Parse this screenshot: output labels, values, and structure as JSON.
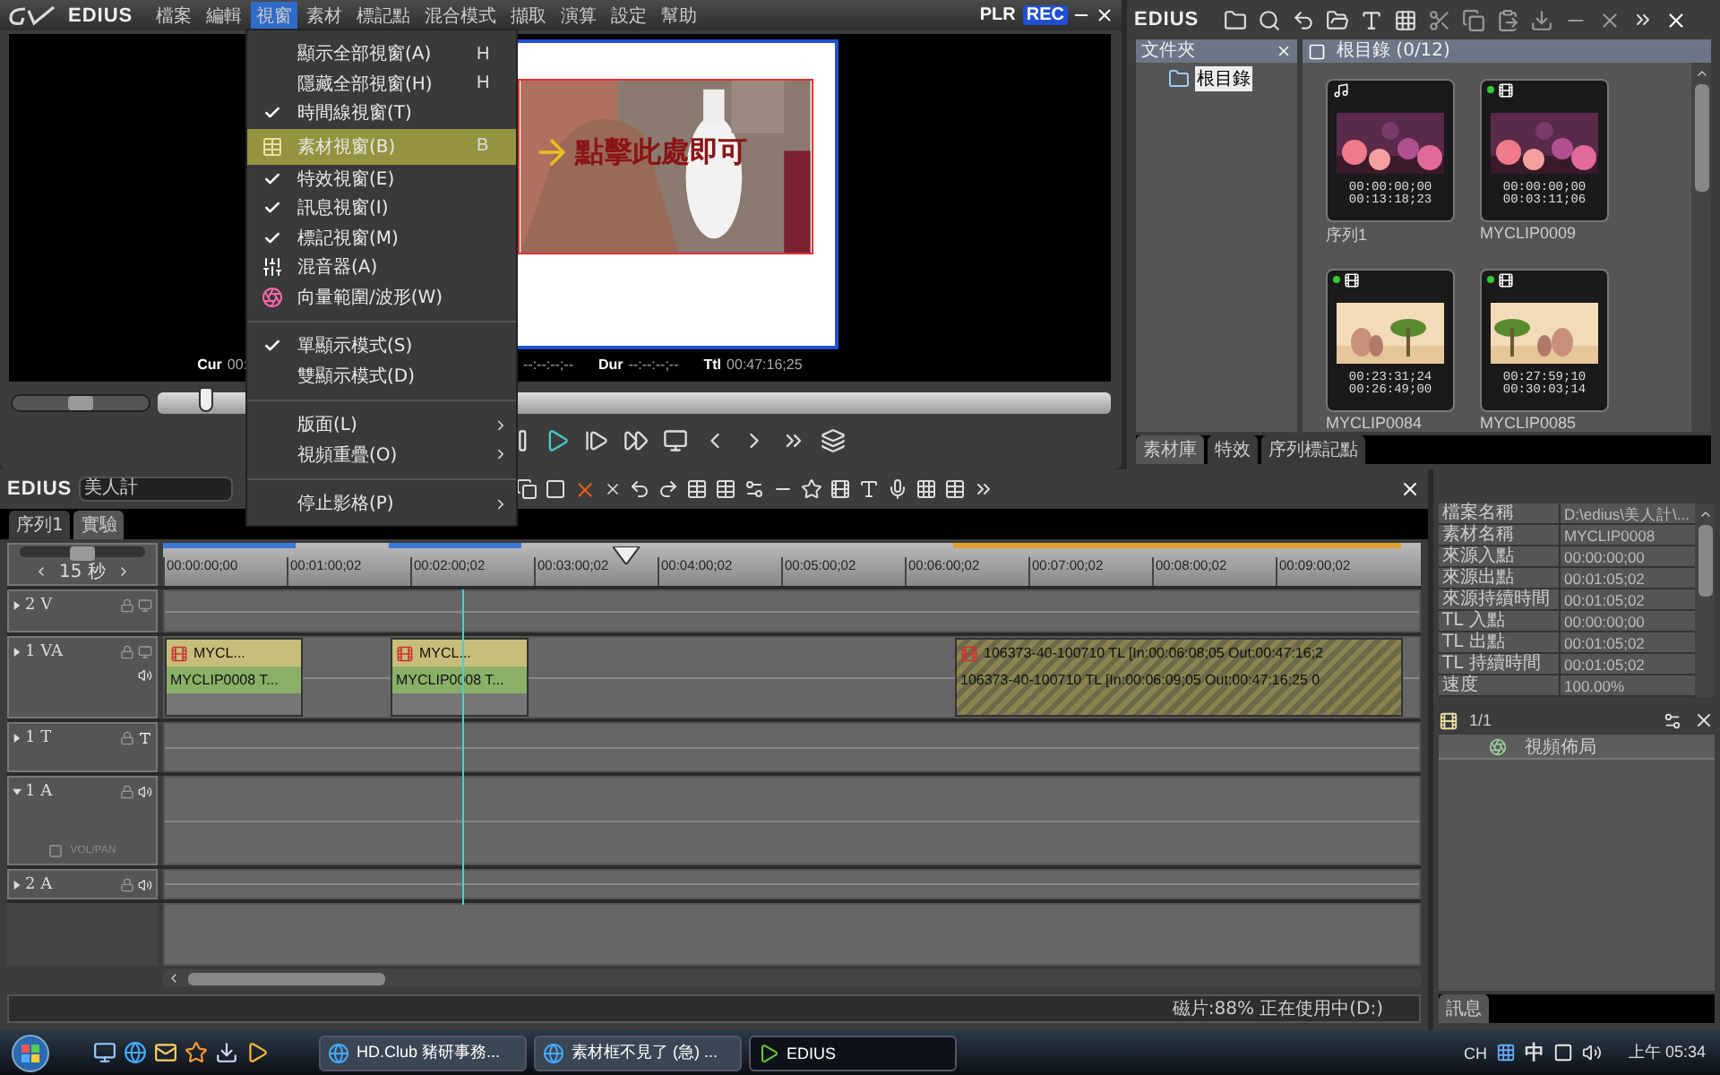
{
  "menubar": {
    "logo": "EDIUS",
    "items": [
      {
        "label": "檔案",
        "selected": false
      },
      {
        "label": "編輯",
        "selected": false
      },
      {
        "label": "視窗",
        "selected": true
      },
      {
        "label": "素材",
        "selected": false
      },
      {
        "label": "標記點",
        "selected": false
      },
      {
        "label": "混合模式",
        "selected": false
      },
      {
        "label": "擷取",
        "selected": false
      },
      {
        "label": "演算",
        "selected": false
      },
      {
        "label": "設定",
        "selected": false
      },
      {
        "label": "幫助",
        "selected": false
      }
    ],
    "mode_tabs": [
      {
        "label": "PLR",
        "selected": false
      },
      {
        "label": "REC",
        "selected": true
      }
    ]
  },
  "view_menu": [
    {
      "label": "顯示全部視窗(A)",
      "shortcut": "H",
      "kind": "text",
      "checked": false,
      "submenu": false,
      "selected": false
    },
    {
      "label": "隱藏全部視窗(H)",
      "shortcut": "H",
      "kind": "text",
      "checked": false,
      "submenu": false,
      "selected": false
    },
    {
      "label": "時間線視窗(T)",
      "kind": "text",
      "checked": true,
      "submenu": false,
      "selected": false
    },
    {
      "label": "素材視窗(B)",
      "shortcut": "B",
      "kind": "bin",
      "submenu": false,
      "selected": true
    },
    {
      "label": "特效視窗(E)",
      "kind": "text",
      "checked": true,
      "submenu": false,
      "selected": false
    },
    {
      "label": "訊息視窗(I)",
      "kind": "text",
      "checked": true,
      "submenu": false,
      "selected": false
    },
    {
      "label": "標記視窗(M)",
      "kind": "text",
      "checked": true,
      "submenu": false,
      "selected": false
    },
    {
      "label": "混音器(A)",
      "kind": "mixer",
      "submenu": false,
      "selected": false
    },
    {
      "label": "向量範圍/波形(W)",
      "kind": "scope",
      "submenu": false,
      "selected": false
    },
    {
      "kind": "separator"
    },
    {
      "label": "單顯示模式(S)",
      "kind": "text",
      "checked": true,
      "submenu": false,
      "selected": false
    },
    {
      "label": "雙顯示模式(D)",
      "kind": "text",
      "checked": false,
      "submenu": false,
      "selected": false
    },
    {
      "kind": "separator"
    },
    {
      "label": "版面(L)",
      "kind": "text",
      "checked": false,
      "submenu": true,
      "selected": false
    },
    {
      "label": "視頻重疊(O)",
      "kind": "text",
      "checked": false,
      "submenu": true,
      "selected": false
    },
    {
      "kind": "separator"
    },
    {
      "label": "停止影格(P)",
      "kind": "text",
      "checked": false,
      "submenu": true,
      "selected": false
    }
  ],
  "player": {
    "annotation": "點擊此處即可",
    "jog": {
      "level": 0.5
    },
    "shuttle": {
      "level": 0.05
    },
    "timecodes": [
      {
        "label": "Cur",
        "value": "00:"
      },
      {
        "value": "--:--:--;--"
      },
      {
        "label": "Dur",
        "value": "--:--:--;--"
      },
      {
        "label": "Ttl",
        "value": "00:47:16;25"
      }
    ]
  },
  "bin": {
    "title": "EDIUS",
    "folder_pane": {
      "title": "文件夾",
      "items": [
        {
          "label": "根目錄",
          "selected": true
        }
      ]
    },
    "clip_pane_title": "根目錄 (0/12)",
    "clips": [
      {
        "kind": "sequence",
        "online": false,
        "tc_in": "00:00:00;00",
        "tc_out": "00:13:18;23",
        "name": "序列1"
      },
      {
        "kind": "clip",
        "online": true,
        "tc_in": "00:00:00;00",
        "tc_out": "00:03:11;06",
        "name": "MYCLIP0009"
      },
      {
        "kind": "clip",
        "online": true,
        "tc_in": "00:23:31;24",
        "tc_out": "00:26:49;00",
        "name": "MYCLIP0084"
      },
      {
        "kind": "clip",
        "online": true,
        "tc_in": "00:27:59;10",
        "tc_out": "00:30:03;14",
        "name": "MYCLIP0085"
      }
    ],
    "tabs": [
      {
        "label": "素材庫",
        "selected": true
      },
      {
        "label": "特效",
        "selected": false
      },
      {
        "label": "序列標記點",
        "selected": false
      }
    ]
  },
  "timeline": {
    "title": "EDIUS",
    "project": "美人計",
    "tabs": [
      {
        "label": "序列1",
        "selected": false
      },
      {
        "label": "實驗",
        "selected": true
      }
    ],
    "scale": "15 秒",
    "ruler": [
      "00:00:00;00",
      "00:01:00;02",
      "00:02:00;02",
      "00:03:00;02",
      "00:04:00;02",
      "00:05:00;02",
      "00:06:00;02",
      "00:07:00;02",
      "00:08:00;02",
      "00:09:00;02"
    ],
    "tracks": [
      {
        "name": "2 V",
        "kind": "video",
        "expanded": false
      },
      {
        "name": "1 VA",
        "kind": "va",
        "expanded": false,
        "clips": [
          {
            "kind": "clip",
            "top": "MYCL...",
            "bottom": "MYCLIP0008  T..."
          },
          {
            "kind": "clip",
            "top": "MYCL...",
            "bottom": "MYCLIP0008  T..."
          },
          {
            "kind": "hatched",
            "top": "106373-40-100710  TL [In:00:06:08;05 Out:00:47:16;2",
            "bottom": "106373-40-100710  TL [In:00:06:09;05 Out:00:47:16;25 0"
          }
        ]
      },
      {
        "name": "1 T",
        "kind": "title",
        "expanded": false
      },
      {
        "name": "1 A",
        "kind": "audio",
        "expanded": true,
        "volpan": "VOL/PAN"
      },
      {
        "name": "2 A",
        "kind": "audio",
        "expanded": false
      }
    ],
    "status": "磁片:88% 正在使用中(D:)"
  },
  "info": {
    "properties": [
      {
        "name": "檔案名稱",
        "value": "D:\\edius\\美人計\\..."
      },
      {
        "name": "素材名稱",
        "value": "MYCLIP0008"
      },
      {
        "name": "來源入點",
        "value": "00:00:00;00"
      },
      {
        "name": "來源出點",
        "value": "00:01:05;02"
      },
      {
        "name": "來源持續時間",
        "value": "00:01:05;02"
      },
      {
        "name": "TL 入點",
        "value": "00:00:00;00"
      },
      {
        "name": "TL 出點",
        "value": "00:01:05;02"
      },
      {
        "name": "TL 持續時間",
        "value": "00:01:05;02"
      },
      {
        "name": "速度",
        "value": "100.00%"
      }
    ],
    "layout_count": "1/1",
    "layouts": [
      {
        "label": "視頻佈局"
      }
    ],
    "tabs": [
      {
        "label": "訊息",
        "selected": true
      }
    ]
  },
  "taskbar": {
    "tasks": [
      {
        "label": "HD.Club 豬研事務...",
        "kind": "browser",
        "selected": false
      },
      {
        "label": "素材框不見了 (急) ...",
        "kind": "browser",
        "selected": false
      },
      {
        "label": "EDIUS",
        "kind": "edius",
        "selected": true
      }
    ],
    "tray": {
      "language": "CH",
      "ime": "中",
      "time": "上午 05:34"
    }
  }
}
